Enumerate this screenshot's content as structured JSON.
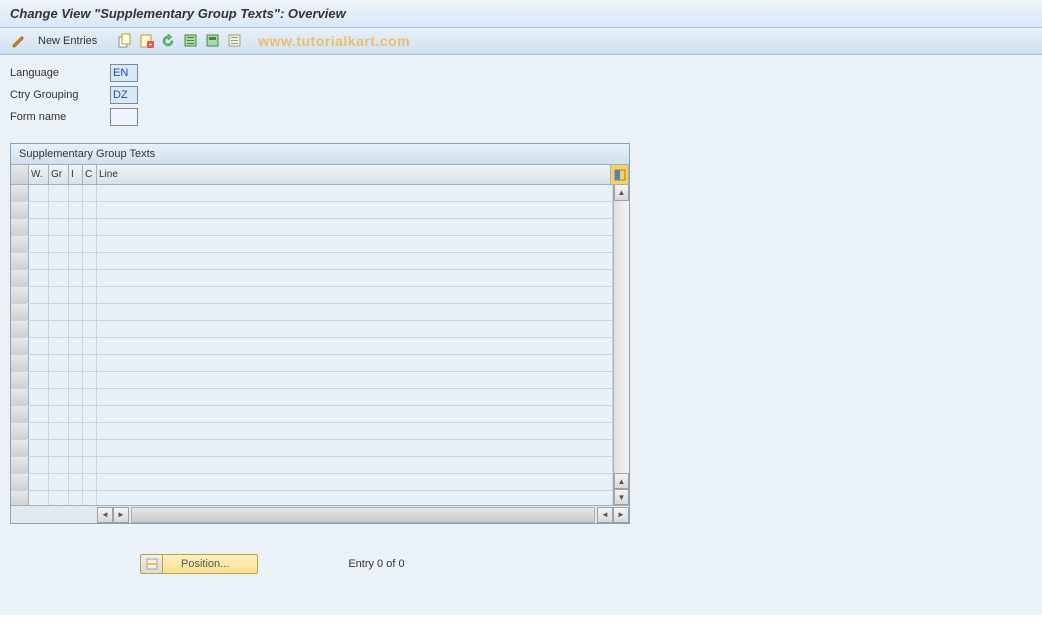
{
  "title": "Change View \"Supplementary Group Texts\": Overview",
  "toolbar": {
    "new_entries_label": "New Entries"
  },
  "watermark": "www.tutorialkart.com",
  "form": {
    "language_label": "Language",
    "language_value": "EN",
    "ctry_grouping_label": "Ctry Grouping",
    "ctry_grouping_value": "DZ",
    "form_name_label": "Form name",
    "form_name_value": ""
  },
  "table": {
    "title": "Supplementary Group Texts",
    "columns": {
      "c1": "W.",
      "c2": "Gr",
      "c3": "I",
      "c4": "C",
      "c5": "Line"
    },
    "empty_rows": 19
  },
  "footer": {
    "position_label": "Position...",
    "entry_text": "Entry 0 of 0"
  }
}
